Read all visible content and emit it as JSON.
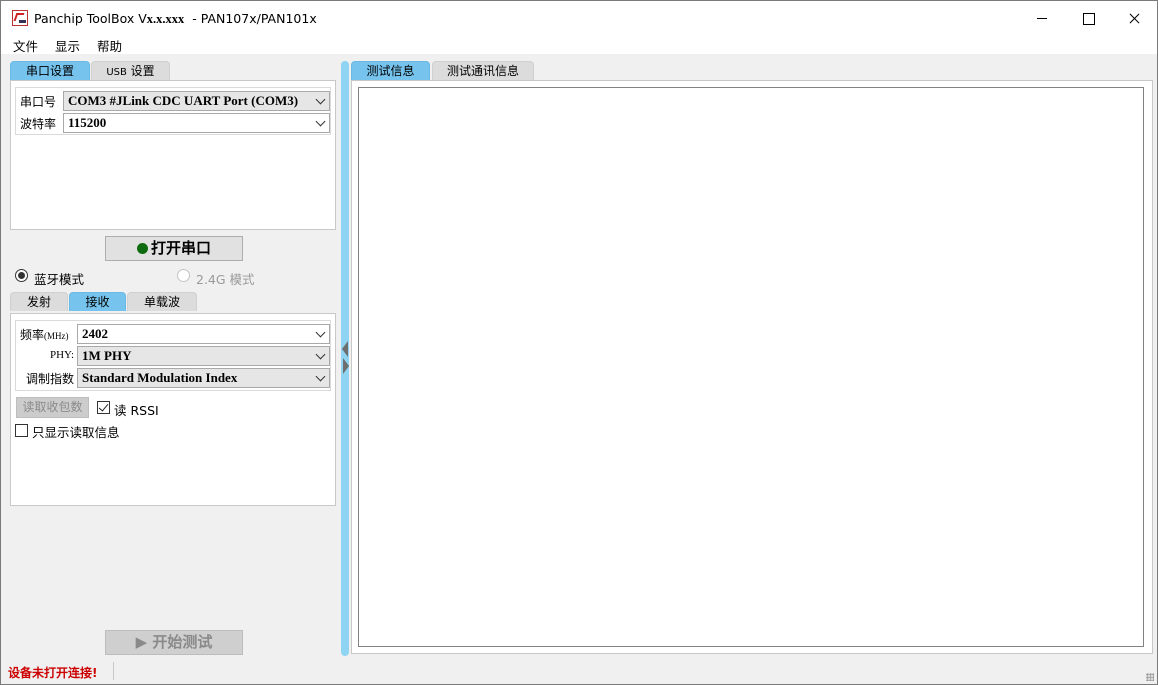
{
  "window": {
    "title_prefix": "Panchip ToolBox V",
    "title_version": "x.x.xxx",
    "title_suffix": "  - PAN107x/PAN101x"
  },
  "menu": [
    "文件",
    "显示",
    "帮助"
  ],
  "left": {
    "tabs": [
      "串口设置",
      "USB",
      "设置"
    ],
    "serial": {
      "port_label": "串口号",
      "port_value": "COM3 #JLink CDC UART Port (COM3)",
      "baud_label": "波特率",
      "baud_value": "115200"
    },
    "open_button": "打开串口",
    "modes": {
      "ble": "蓝牙模式",
      "g24": "2.4G 模式",
      "selected": "ble"
    },
    "mode_tabs": [
      "发射",
      "接收",
      "单载波"
    ],
    "rx": {
      "freq_label": "频率",
      "freq_unit": "(MHz)",
      "freq_value": "2402",
      "phy_label": "PHY:",
      "phy_value": "1M PHY",
      "mod_label": "调制指数",
      "mod_value": "Standard Modulation Index",
      "read_button": "读取收包数",
      "rssi_label": "读 RSSI",
      "rssi_checked": true,
      "only_show_label": "只显示读取信息",
      "only_show_checked": false
    },
    "start_button": "开始测试"
  },
  "right": {
    "tabs": [
      "测试信息",
      "测试通讯信息"
    ],
    "active_tab": 0
  },
  "status": {
    "message": "设备未打开连接!"
  },
  "colors": {
    "active_tab": "#76c4ee",
    "splitter": "#8fd4f2",
    "status_error": "#cc0000",
    "connect_dot": "#0f6b0f"
  }
}
